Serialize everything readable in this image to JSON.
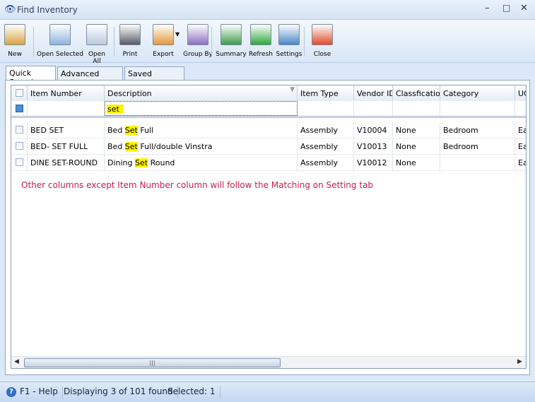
{
  "window": {
    "title": "Find Inventory",
    "icon": "binoculars-icon"
  },
  "toolbar": [
    {
      "label": "New",
      "icon": "new-box-icon",
      "color": "#d9a441"
    },
    {
      "label": "Open Selected",
      "icon": "open-selected-icon",
      "color": "#8fb3dd"
    },
    {
      "label": "Open All",
      "icon": "open-all-icon",
      "color": "#b9c9dc"
    },
    {
      "label": "Print",
      "icon": "printer-icon",
      "color": "#555b66"
    },
    {
      "label": "Export",
      "icon": "export-icon",
      "color": "#e39a3a"
    },
    {
      "label": "Group By",
      "icon": "group-by-icon",
      "color": "#8b6fc0"
    },
    {
      "label": "Summary",
      "icon": "summary-icon",
      "color": "#3f9a4a"
    },
    {
      "label": "Refresh",
      "icon": "refresh-icon",
      "color": "#2fa83c"
    },
    {
      "label": "Settings",
      "icon": "settings-icon",
      "color": "#4a86c8"
    },
    {
      "label": "Close",
      "icon": "close-window-icon",
      "color": "#e04b2c"
    }
  ],
  "tabs": [
    {
      "label": "Quick Search",
      "active": true
    },
    {
      "label": "Advanced Search"
    },
    {
      "label": "Saved Searches"
    }
  ],
  "grid": {
    "columns": [
      "Item Number",
      "Description",
      "Item Type",
      "Vendor ID",
      "Classfication",
      "Category",
      "UC"
    ],
    "filter": {
      "description": "set"
    },
    "rows": [
      {
        "item": "BED SET",
        "desc_pre": "Bed ",
        "desc_hl": "Set",
        "desc_post": " Full",
        "type": "Assembly",
        "vendor": "V10004",
        "class": "None",
        "category": "Bedroom",
        "uc": "Ea"
      },
      {
        "item": "BED- SET FULL",
        "desc_pre": "Bed ",
        "desc_hl": "Set",
        "desc_post": " Full/double Vinstra",
        "type": "Assembly",
        "vendor": "V10013",
        "class": "None",
        "category": "Bedroom",
        "uc": "Ea"
      },
      {
        "item": "DINE SET-ROUND",
        "desc_pre": "Dining ",
        "desc_hl": "Set",
        "desc_post": " Round",
        "type": "Assembly",
        "vendor": "V10012",
        "class": "None",
        "category": "",
        "uc": "Ea"
      }
    ]
  },
  "message": "Other columns except Item Number column will follow the Matching on Setting tab",
  "status": {
    "help": "F1 - Help",
    "displaying": "Displaying 3 of 101 found",
    "selected": "Selected: 1"
  },
  "colors": {
    "highlight": "#fff200",
    "message": "#c41f4b"
  }
}
